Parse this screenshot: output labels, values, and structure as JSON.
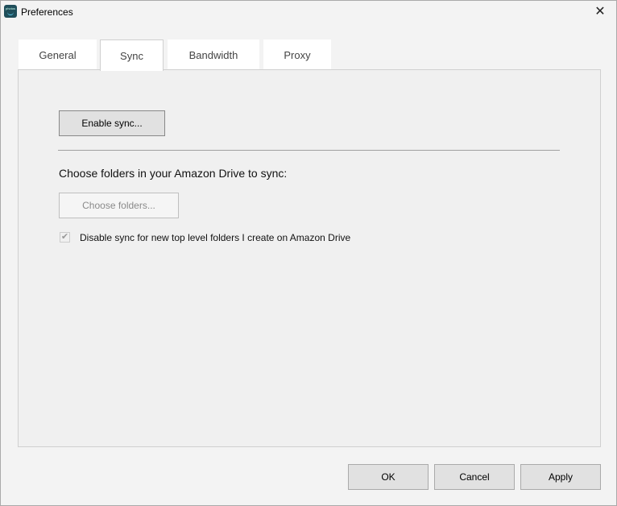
{
  "window": {
    "title": "Preferences",
    "app_icon": "photos",
    "close_icon": "close-icon"
  },
  "tabs": [
    {
      "label": "General"
    },
    {
      "label": "Sync",
      "active": true
    },
    {
      "label": "Bandwidth"
    },
    {
      "label": "Proxy"
    }
  ],
  "sync": {
    "enable_button": "Enable sync...",
    "choose_label": "Choose folders in your Amazon Drive to sync:",
    "choose_button": "Choose folders...",
    "checkbox_label": "Disable sync for new top level folders I create on Amazon Drive",
    "checkbox_checked": true,
    "checkbox_disabled": true
  },
  "footer": {
    "ok": "OK",
    "cancel": "Cancel",
    "apply": "Apply"
  }
}
